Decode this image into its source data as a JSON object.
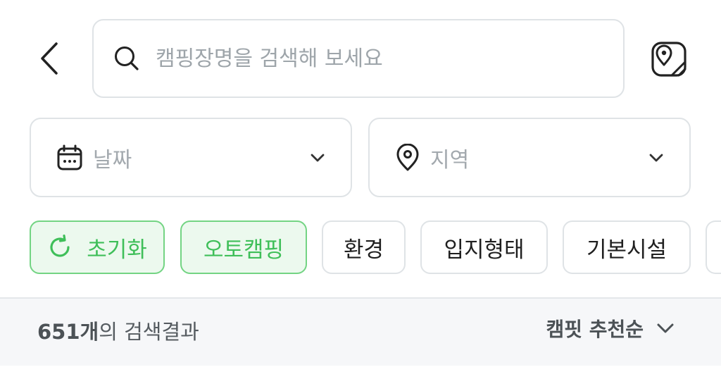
{
  "search": {
    "placeholder": "캠핑장명을 검색해 보세요"
  },
  "filters": {
    "date_label": "날짜",
    "region_label": "지역"
  },
  "chips": [
    {
      "label": "초기화",
      "active": true
    },
    {
      "label": "오토캠핑",
      "active": true
    },
    {
      "label": "환경",
      "active": false
    },
    {
      "label": "입지형태",
      "active": false
    },
    {
      "label": "기본시설",
      "active": false
    }
  ],
  "results": {
    "count": "651개",
    "count_suffix": "의 검색결과",
    "sort_label": "캠핏 추천순"
  },
  "colors": {
    "accent": "#3fbf59",
    "accent_bg": "#ecf9ee",
    "border": "#dfe3e6"
  },
  "icons": [
    "back-arrow-icon",
    "search-icon",
    "map-icon",
    "calendar-icon",
    "location-pin-icon",
    "chevron-down-icon",
    "refresh-icon"
  ]
}
